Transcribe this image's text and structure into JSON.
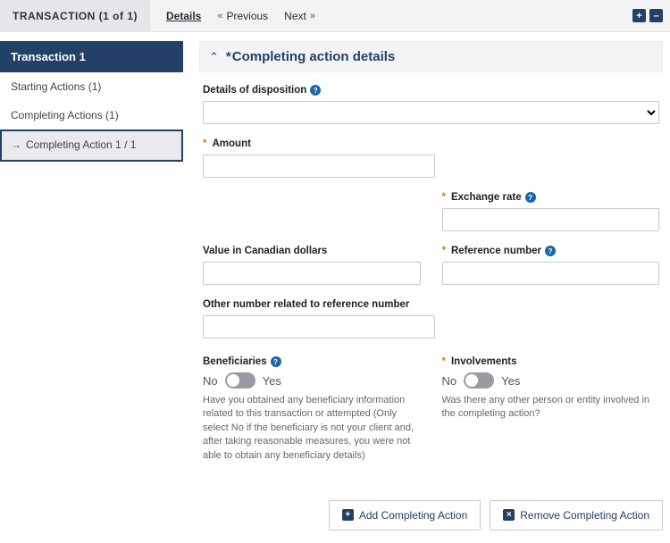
{
  "topbar": {
    "title": "TRANSACTION (1 of 1)",
    "details": "Details",
    "prev": "Previous",
    "next": "Next"
  },
  "sidebar": {
    "header": "Transaction 1",
    "starting": "Starting Actions (1)",
    "completing": "Completing Actions (1)",
    "active": "Completing Action 1 / 1"
  },
  "section": {
    "title": "Completing action details"
  },
  "fields": {
    "disposition": "Details of disposition",
    "amount": "Amount",
    "exrate": "Exchange rate",
    "cad": "Value in Canadian dollars",
    "refnum": "Reference number",
    "othernum": "Other number related to reference number"
  },
  "beneficiaries": {
    "label": "Beneficiaries",
    "no": "No",
    "yes": "Yes",
    "help": "Have you obtained any beneficiary information related to this transaction or attempted (Only select No if the beneficiary is not your client and, after taking reasonable measures, you were not able to obtain any beneficiary details)"
  },
  "involvements": {
    "label": "Involvements",
    "no": "No",
    "yes": "Yes",
    "help": "Was there any other person or entity involved in the completing action?"
  },
  "buttons": {
    "add": "Add Completing Action",
    "remove": "Remove Completing Action"
  }
}
